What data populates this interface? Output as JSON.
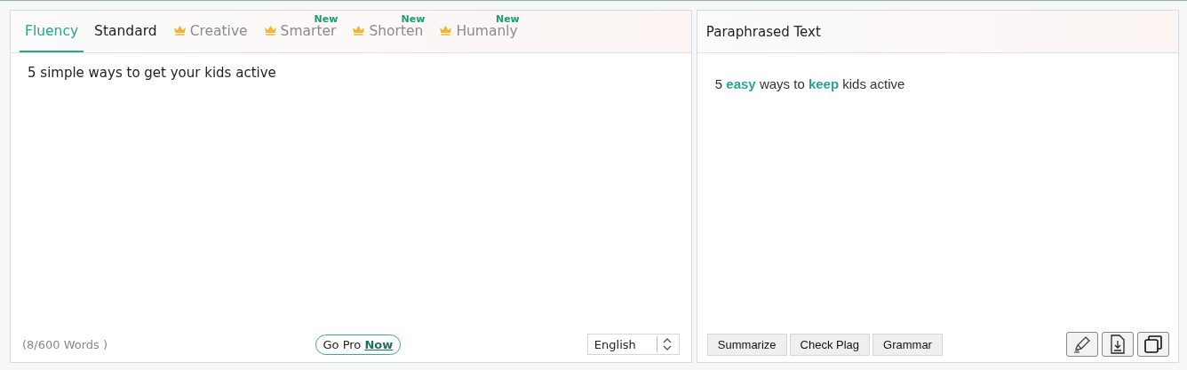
{
  "input_panel": {
    "tabs": [
      {
        "label": "Fluency",
        "selected": true,
        "premium": false
      },
      {
        "label": "Standard",
        "selected": false,
        "premium": false
      },
      {
        "label": "Creative",
        "selected": false,
        "premium": true
      },
      {
        "label": "Smarter",
        "selected": false,
        "premium": true,
        "badge": "New"
      },
      {
        "label": "Shorten",
        "selected": false,
        "premium": true,
        "badge": "New"
      },
      {
        "label": "Humanly",
        "selected": false,
        "premium": true,
        "badge": "New"
      }
    ],
    "text": "5 simple ways to get your kids active",
    "word_count": "(8/600 Words )",
    "go_pro": "Go Pro **Now**",
    "language": "English"
  },
  "output_panel": {
    "title": "Paraphrased Text",
    "text": "5 **easy** ways to **keep** kids active",
    "buttons": [
      "Summarize",
      "Check Plag",
      "Grammar"
    ]
  }
}
